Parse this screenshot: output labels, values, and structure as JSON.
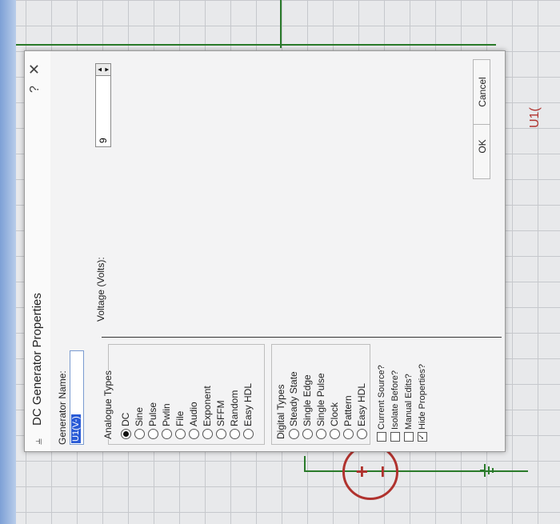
{
  "dialog": {
    "title": "DC Generator Properties",
    "help_symbol": "?",
    "close_symbol": "✕",
    "generator_name_label": "Generator Name:",
    "generator_name_value": "U1(V-)",
    "voltage_label": "Voltage (Volts):",
    "voltage_value": "9",
    "analogue_title": "Analogue Types",
    "analogue_types": [
      "DC",
      "Sine",
      "Pulse",
      "Pwlin",
      "File",
      "Audio",
      "Exponent",
      "SFFM",
      "Random",
      "Easy HDL"
    ],
    "analogue_selected": "DC",
    "digital_title": "Digital Types",
    "digital_types": [
      "Steady State",
      "Single Edge",
      "Single Pulse",
      "Clock",
      "Pattern",
      "Easy HDL"
    ],
    "options": [
      {
        "label": "Current Source?",
        "checked": false
      },
      {
        "label": "Isolate Before?",
        "checked": false
      },
      {
        "label": "Manual Edits?",
        "checked": false
      },
      {
        "label": "Hide Properties?",
        "checked": true
      }
    ],
    "ok_label": "OK",
    "cancel_label": "Cancel"
  },
  "schematic": {
    "component_label": "U1(",
    "plus_sign": "+",
    "minus_sign": "−"
  },
  "colors": {
    "wire": "#2a7a2a",
    "component": "#b0322e",
    "selection": "#2a5bd6"
  }
}
